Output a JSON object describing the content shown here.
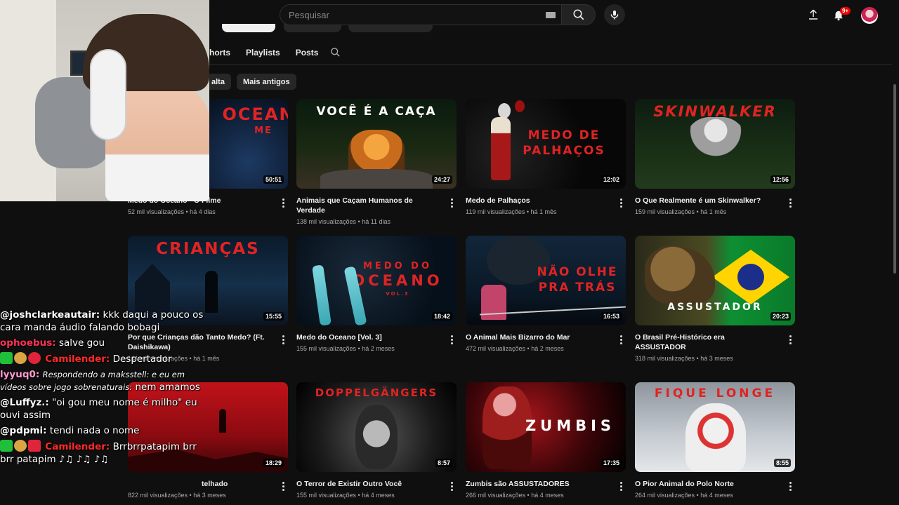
{
  "search": {
    "placeholder": "Pesquisar"
  },
  "notifications": {
    "badge": "9+"
  },
  "tabs": [
    "horts",
    "Playlists",
    "Posts"
  ],
  "chips": [
    "alta",
    "Mais antigos"
  ],
  "videos": [
    {
      "thumb_text": "OCEANO",
      "thumb_sub": "ME",
      "duration": "50:51",
      "title": "Medo do Oceano - O Filme",
      "meta": "52 mil visualizações • há 4 dias"
    },
    {
      "thumb_text": "VOCÊ É A CAÇA",
      "duration": "24:27",
      "title": "Animais que Caçam Humanos de Verdade",
      "meta": "138 mil visualizações • há 11 dias"
    },
    {
      "thumb_text": "MEDO DE",
      "thumb_sub": "PALHAÇOS",
      "duration": "12:02",
      "title": "Medo de Palhaços",
      "meta": "119 mil visualizações • há 1 mês"
    },
    {
      "thumb_text": "SKINWALKER",
      "duration": "12:56",
      "title": "O Que Realmente é um Skinwalker?",
      "meta": "159 mil visualizações • há 1 mês"
    },
    {
      "thumb_text": "CRIANÇAS",
      "duration": "15:55",
      "title": "Por que Crianças dão Tanto Medo? (Ft. Daishikawa)",
      "meta": "141 mil visualizações • há 1 mês"
    },
    {
      "thumb_text": "MEDO DO",
      "thumb_sub": "OCEANO",
      "thumb_small": "VOL.3",
      "duration": "18:42",
      "title": "Medo do Oceano [Vol. 3]",
      "meta": "155 mil visualizações • há 2 meses"
    },
    {
      "thumb_text": "NÃO OLHE",
      "thumb_sub": "PRA TRÁS",
      "duration": "16:53",
      "title": "O Animal Mais Bizarro do Mar",
      "meta": "472 mil visualizações • há 2 meses"
    },
    {
      "thumb_text": "ASSUSTADOR",
      "duration": "20:23",
      "title": "O Brasil Pré-Histórico era ASSUSTADOR",
      "meta": "318 mil visualizações • há 3 meses"
    },
    {
      "thumb_text": "",
      "duration": "18:29",
      "title": "telhado",
      "meta": "822 mil visualizações • há 3 meses"
    },
    {
      "thumb_text": "DOPPELGÄNGERS",
      "duration": "8:57",
      "title": "O Terror de Existir Outro Você",
      "meta": "155 mil visualizações • há 4 meses"
    },
    {
      "thumb_text": "ZUMBIS",
      "duration": "17:35",
      "title": "Zumbis são ASSUSTADORES",
      "meta": "266 mil visualizações • há 4 meses"
    },
    {
      "thumb_text": "FIQUE LONGE",
      "duration": "8:55",
      "title": "O Pior Animal do Polo Norte",
      "meta": "264 mil visualizações • há 4 meses"
    }
  ],
  "chat": [
    {
      "user": "@joshclarkeautair:",
      "user_color": "#ffffff",
      "text": "kkk daqui a pouco os cara manda áudio falando bobagi"
    },
    {
      "user": "ophoebus:",
      "user_color": "#ff3355",
      "text": "salve gou"
    },
    {
      "user": "Camilender:",
      "user_color": "#ff2a2a",
      "text": "Despertador",
      "badges": true
    },
    {
      "user": "lyyuq0:",
      "user_color": "#ff9bd0",
      "reply": "Respondendo a maksstell: e eu em vídeos sobre jogo sobrenaturais:",
      "text": "nem amamos"
    },
    {
      "user": "@Luffyz.:",
      "user_color": "#ffffff",
      "text": "\"oi gou meu nome é milho\" eu ouvi assim"
    },
    {
      "user": "@pdpmi:",
      "user_color": "#ffffff",
      "text": "tendi nada o nome"
    },
    {
      "user": "Camilender:",
      "user_color": "#ff2a2a",
      "text": "Brrbrrpatapim brr brr patapim ♪♫ ♪♫ ♪♫",
      "badges": true
    }
  ]
}
